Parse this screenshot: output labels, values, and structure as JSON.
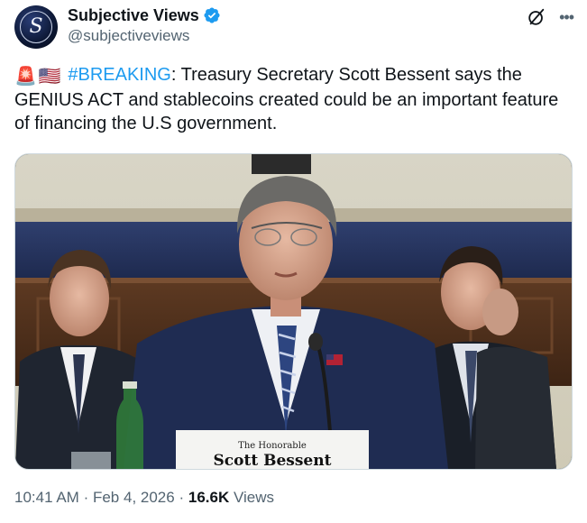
{
  "author": {
    "display_name": "Subjective Views",
    "handle": "@subjectiveviews",
    "avatar_letter": "S",
    "verified_color": "#1d9bf0"
  },
  "post": {
    "emoji_1": "🚨",
    "emoji_2": "🇺🇸",
    "hashtag": "#BREAKING",
    "text": ": Treasury Secretary Scott Bessent says the GENIUS ACT and stablecoins created could be an important feature of financing the U.S government."
  },
  "media": {
    "placard_line1": "The Honorable",
    "placard_line2": "Scott Bessent"
  },
  "footer": {
    "time": "10:41 AM",
    "sep1": "·",
    "date": "Feb 4, 2026",
    "sep2": "·",
    "views_count": "16.6K",
    "views_label": "Views"
  },
  "colors": {
    "text_primary": "#0f1419",
    "text_secondary": "#536471",
    "link": "#1d9bf0"
  },
  "icons": {
    "grok": "grok-icon",
    "more": "more-icon",
    "verified": "verified-badge-icon"
  }
}
